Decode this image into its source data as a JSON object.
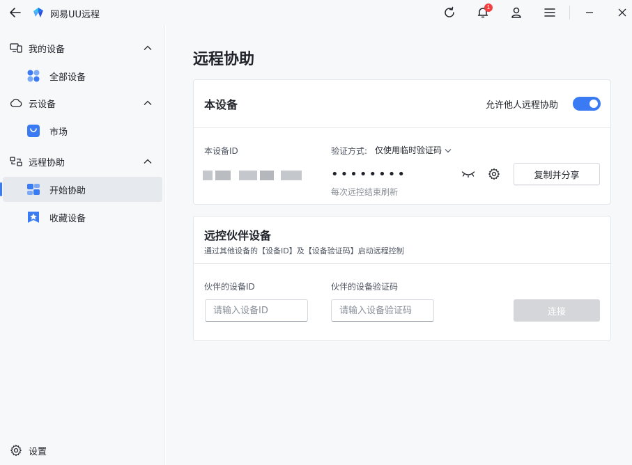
{
  "app": {
    "title": "网易UU远程",
    "notification_count": "1",
    "accent_color": "#3a7bf4"
  },
  "titlebar": {
    "icons": [
      "back-arrow-icon",
      "refresh-icon",
      "bell-icon",
      "user-icon",
      "menu-icon",
      "minimize-icon",
      "close-icon"
    ]
  },
  "sidebar": {
    "groups": [
      {
        "label": "我的设备",
        "icon": "devices-icon",
        "items": [
          {
            "label": "全部设备",
            "icon": "grid-icon"
          }
        ]
      },
      {
        "label": "云设备",
        "icon": "cloud-icon",
        "items": [
          {
            "label": "市场",
            "icon": "shopping-bag-icon"
          }
        ]
      },
      {
        "label": "远程协助",
        "icon": "remote-icon",
        "items": [
          {
            "label": "开始协助",
            "icon": "assist-icon",
            "active": true
          },
          {
            "label": "收藏设备",
            "icon": "star-icon"
          }
        ]
      }
    ],
    "settings_label": "设置"
  },
  "main": {
    "page_title": "远程协助",
    "this_device": {
      "title": "本设备",
      "allow_label": "允许他人远程协助",
      "allow_enabled": true,
      "device_id_label": "本设备ID",
      "verify_method_label": "验证方式:",
      "verify_method_value": "仅使用临时验证码",
      "password_masked": "••••••••",
      "refresh_note": "每次远控结束刷新",
      "copy_share_label": "复制并分享"
    },
    "partner": {
      "title": "远控伙伴设备",
      "subtitle": "通过其他设备的【设备ID】及【设备验证码】启动远程控制",
      "device_id_label": "伙伴的设备ID",
      "device_id_placeholder": "请输入设备ID",
      "code_label": "伙伴的设备验证码",
      "code_placeholder": "请输入设备验证码",
      "connect_label": "连接"
    }
  }
}
